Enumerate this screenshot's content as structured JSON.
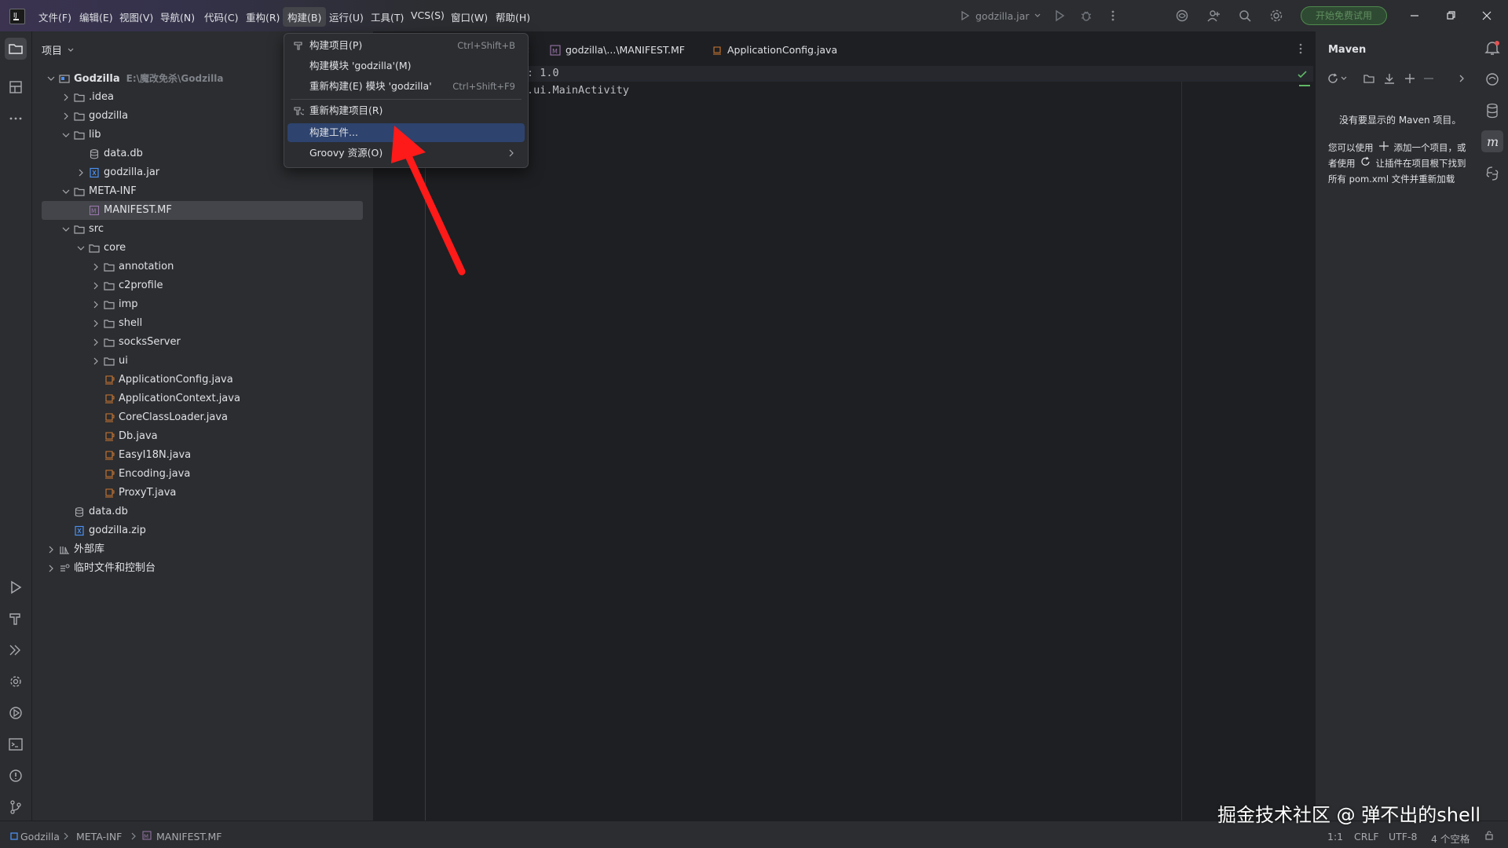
{
  "menubar": {
    "items": [
      "文件(F)",
      "编辑(E)",
      "视图(V)",
      "导航(N)",
      "代码(C)",
      "重构(R)",
      "构建(B)",
      "运行(U)",
      "工具(T)",
      "VCS(S)",
      "窗口(W)",
      "帮助(H)"
    ],
    "active": "构建(B)",
    "run_config": "godzilla.jar",
    "trial_button": "开始免费试用"
  },
  "project_panel": {
    "title": "项目",
    "tree": [
      {
        "label": "Godzilla",
        "path": "E:\\魔改免杀\\Godzilla",
        "type": "module"
      },
      {
        "label": ".idea",
        "type": "folder"
      },
      {
        "label": "godzilla",
        "type": "folder"
      },
      {
        "label": "lib",
        "type": "folder"
      },
      {
        "label": "data.db",
        "type": "db"
      },
      {
        "label": "godzilla.jar",
        "type": "jar"
      },
      {
        "label": "META-INF",
        "type": "folder"
      },
      {
        "label": "MANIFEST.MF",
        "type": "manifest",
        "selected": true
      },
      {
        "label": "src",
        "type": "folder"
      },
      {
        "label": "core",
        "type": "folder"
      },
      {
        "label": "annotation",
        "type": "folder"
      },
      {
        "label": "c2profile",
        "type": "folder"
      },
      {
        "label": "imp",
        "type": "folder"
      },
      {
        "label": "shell",
        "type": "folder"
      },
      {
        "label": "socksServer",
        "type": "folder"
      },
      {
        "label": "ui",
        "type": "folder"
      },
      {
        "label": "ApplicationConfig.java",
        "type": "java"
      },
      {
        "label": "ApplicationContext.java",
        "type": "java"
      },
      {
        "label": "CoreClassLoader.java",
        "type": "java"
      },
      {
        "label": "Db.java",
        "type": "java"
      },
      {
        "label": "EasyI18N.java",
        "type": "java"
      },
      {
        "label": "Encoding.java",
        "type": "java"
      },
      {
        "label": "ProxyT.java",
        "type": "java"
      },
      {
        "label": "data.db",
        "type": "db"
      },
      {
        "label": "godzilla.zip",
        "type": "zip"
      },
      {
        "label": "外部库",
        "type": "lib"
      },
      {
        "label": "临时文件和控制台",
        "type": "scratch"
      }
    ]
  },
  "editor": {
    "tabs": [
      {
        "label": "godzilla\\...\\MANIFEST.MF"
      },
      {
        "label": "ApplicationConfig.java"
      }
    ],
    "lines": [
      ": 1.0",
      ".ui.MainActivity"
    ]
  },
  "build_menu": {
    "items": [
      {
        "label": "构建项目(P)",
        "shortcut": "Ctrl+Shift+B"
      },
      {
        "label": "构建模块 'godzilla'(M)",
        "shortcut": ""
      },
      {
        "label": "重新构建(E) 模块 'godzilla'",
        "shortcut": "Ctrl+Shift+F9"
      },
      {
        "label": "重新构建项目(R)",
        "shortcut": ""
      },
      {
        "label": "构建工件...",
        "shortcut": "",
        "highlighted": true
      },
      {
        "label": "Groovy 资源(O)",
        "shortcut": "",
        "submenu": true
      }
    ]
  },
  "maven_panel": {
    "title": "Maven",
    "empty_title": "没有要显示的 Maven 项目。",
    "hint_1": "您可以使用",
    "hint_2": "添加一个项目，或",
    "hint_3": "者使用",
    "hint_4": "让插件在项目根下找到",
    "hint_5": "所有 pom.xml 文件并重新加载"
  },
  "statusbar": {
    "breadcrumb": [
      "Godzilla",
      "META-INF",
      "MANIFEST.MF"
    ],
    "position": "1:1",
    "line_sep": "CRLF",
    "encoding": "UTF-8",
    "indent": "4 个空格"
  },
  "watermark": "掘金技术社区 @ 弹不出的shell",
  "colors": {
    "accent": "#2e436e",
    "arrow": "#ff1a1a",
    "background": "#1e1f22",
    "panel": "#2b2d30"
  }
}
